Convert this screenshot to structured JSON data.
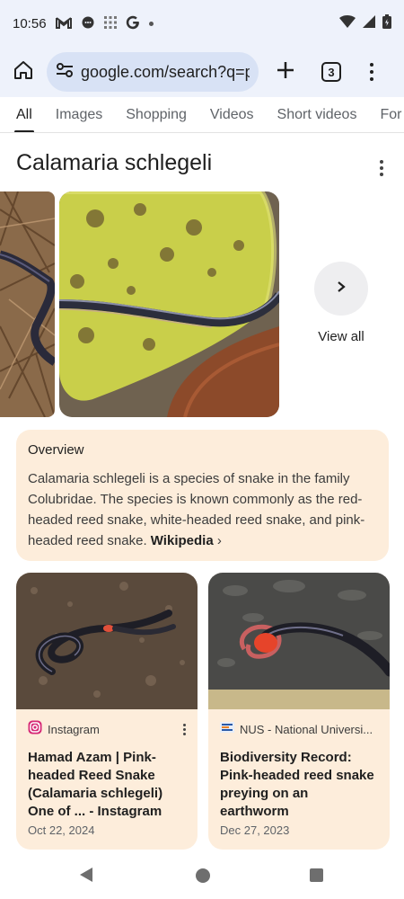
{
  "status": {
    "time": "10:56"
  },
  "browser": {
    "url": "google.com/search?q=p",
    "tab_count": "3"
  },
  "filters": [
    "All",
    "Images",
    "Shopping",
    "Videos",
    "Short videos",
    "For"
  ],
  "result": {
    "title": "Calamaria schlegeli",
    "view_all": "View all",
    "overview": {
      "heading": "Overview",
      "text": "Calamaria schlegeli is a species of snake in the family Colubridae. The species is known commonly as the red-headed reed snake, white-headed reed snake, and pink-headed reed snake.",
      "source": "Wikipedia"
    },
    "cards": [
      {
        "source": "Instagram",
        "title": "Hamad Azam | Pink-headed Reed Snake (Calamaria schlegeli) One of ... - Instagram",
        "date": "Oct 22, 2024"
      },
      {
        "source": "NUS - National Universi...",
        "title": "Biodiversity Record: Pink-headed reed snake preying on an earthworm",
        "date": "Dec 27, 2023"
      }
    ]
  },
  "icons": [
    "gmail-icon",
    "chat-icon",
    "grid-icon",
    "google-icon",
    "wifi-icon",
    "signal-icon",
    "battery-icon",
    "home-icon",
    "site-settings-icon",
    "plus-icon",
    "tabs-icon",
    "more-icon",
    "chevron-right-icon"
  ]
}
